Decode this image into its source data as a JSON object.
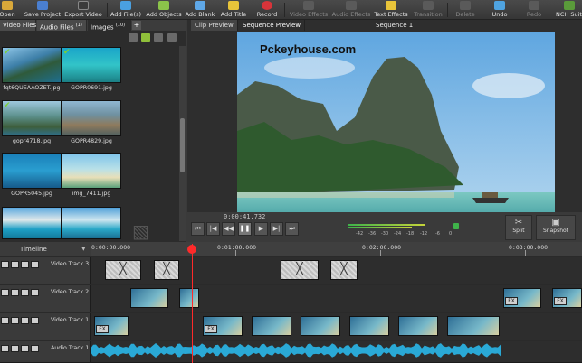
{
  "toolbar": {
    "items": [
      {
        "label": "Open",
        "icon": "folder-icon"
      },
      {
        "label": "Save Project",
        "icon": "save-icon"
      },
      {
        "label": "Export Video",
        "icon": "export-icon"
      },
      {
        "label": "Add File(s)",
        "icon": "add-file-icon"
      },
      {
        "label": "Add Objects",
        "icon": "add-objects-icon"
      },
      {
        "label": "Add Blank",
        "icon": "add-blank-icon"
      },
      {
        "label": "Add Title",
        "icon": "add-title-icon"
      },
      {
        "label": "Record",
        "icon": "record-icon"
      },
      {
        "label": "Video Effects",
        "icon": "video-effects-icon"
      },
      {
        "label": "Audio Effects",
        "icon": "audio-effects-icon"
      },
      {
        "label": "Text Effects",
        "icon": "text-effects-icon"
      },
      {
        "label": "Transition",
        "icon": "transition-icon"
      },
      {
        "label": "Delete",
        "icon": "delete-icon"
      },
      {
        "label": "Undo",
        "icon": "undo-icon"
      },
      {
        "label": "Redo",
        "icon": "redo-icon"
      },
      {
        "label": "NCH Suite",
        "icon": "nch-suite-icon"
      }
    ]
  },
  "media": {
    "tabs": [
      {
        "label": "Video Files",
        "count": ""
      },
      {
        "label": "Audio Files",
        "count": "(1)"
      },
      {
        "label": "Images",
        "count": "(10)"
      }
    ],
    "add_tab": "+",
    "thumbnails": [
      {
        "caption": "fqt6QUEAAOZET.jpg",
        "checked": true
      },
      {
        "caption": "GOPR0691.jpg",
        "checked": true
      },
      {
        "caption": "gopr4718.jpg",
        "checked": true
      },
      {
        "caption": "GOPR4829.jpg",
        "checked": false
      },
      {
        "caption": "GOPR5045.jpg",
        "checked": false
      },
      {
        "caption": "img_7411.jpg",
        "checked": false
      },
      {
        "caption": "",
        "checked": false
      },
      {
        "caption": "",
        "checked": false
      }
    ]
  },
  "preview": {
    "tabs": [
      "Clip Preview",
      "Sequence Preview"
    ],
    "sequence_name": "Sequence 1",
    "watermark": "Pckeyhouse.com",
    "timecode": "0:00:41.732",
    "meter_labels": [
      "-42",
      "-36",
      "-30",
      "-24",
      "-18",
      "-12",
      "-6",
      "0"
    ],
    "split_label": "Split",
    "snapshot_label": "Snapshot"
  },
  "timeline": {
    "label": "Timeline",
    "ruler": [
      "0:00:00.000",
      "0:01:00.000",
      "0:02:00.000",
      "0:03:00.000"
    ],
    "tracks": [
      {
        "name": "Video Track 3"
      },
      {
        "name": "Video Track 2"
      },
      {
        "name": "Video Track 1"
      },
      {
        "name": "Audio Track 1"
      }
    ],
    "fx_label": "FX"
  },
  "colors": {
    "playhead": "#ff2a2a",
    "check": "#7cd135",
    "waveform": "#2aa9d6"
  }
}
